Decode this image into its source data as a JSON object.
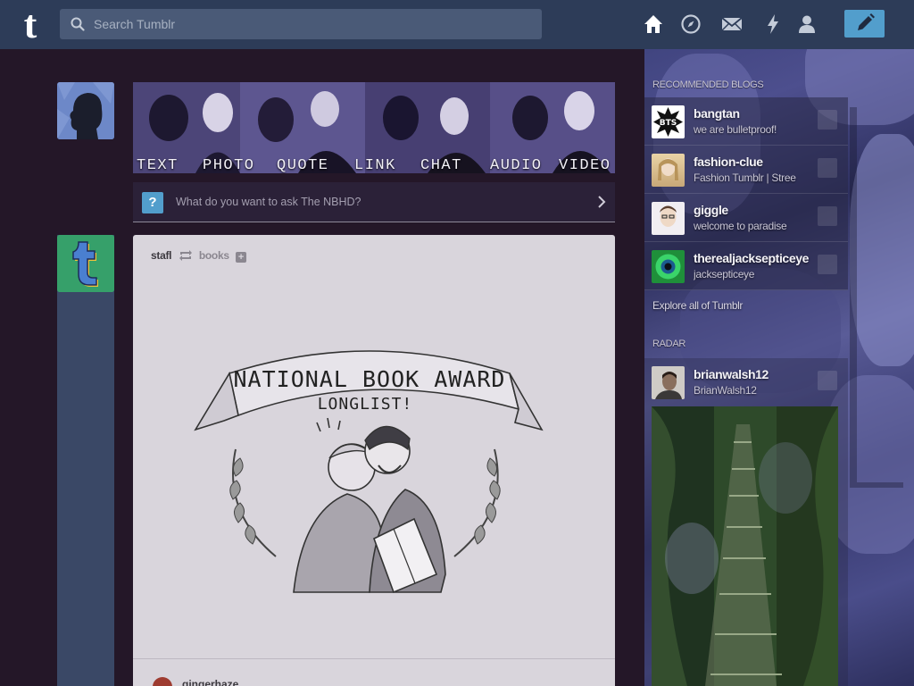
{
  "search": {
    "placeholder": "Search Tumblr"
  },
  "header": {
    "logo": "t",
    "nav": [
      "home-icon",
      "explore-compass-icon",
      "inbox-envelope-icon",
      "activity-lightning-icon",
      "account-person-icon"
    ],
    "compose": "pencil-icon"
  },
  "post_types": [
    "TEXT",
    "PHOTO",
    "QUOTE",
    "LINK",
    "CHAT",
    "AUDIO",
    "VIDEO"
  ],
  "ask_bar": {
    "icon_glyph": "?",
    "prompt": "What do you want to ask The NBHD?"
  },
  "post": {
    "author": "stafl",
    "source": "books",
    "follow_glyph": "+",
    "image": {
      "banner_line1": "NATIONAL BOOK AWARD",
      "banner_line2": "LONGLIST!"
    },
    "reblogger": "gingerhaze"
  },
  "sidebar": {
    "recommended_heading": "RECOMMENDED BLOGS",
    "blogs": [
      {
        "name": "bangtan",
        "desc": "we are bulletproof!",
        "avatar_text": "BTS"
      },
      {
        "name": "fashion-clue",
        "desc": "Fashion Tumblr | Stree"
      },
      {
        "name": "giggle",
        "desc": "welcome to paradise"
      },
      {
        "name": "therealjacksepticeye",
        "desc": "jacksepticeye"
      }
    ],
    "explore": "Explore all of Tumblr",
    "radar_heading": "RADAR",
    "radar": {
      "name": "brianwalsh12",
      "desc": "BrianWalsh12"
    }
  },
  "colors": {
    "header": "#2d3c58",
    "background": "#241728",
    "accent": "#529ecc",
    "card": "#d9d5dc"
  }
}
